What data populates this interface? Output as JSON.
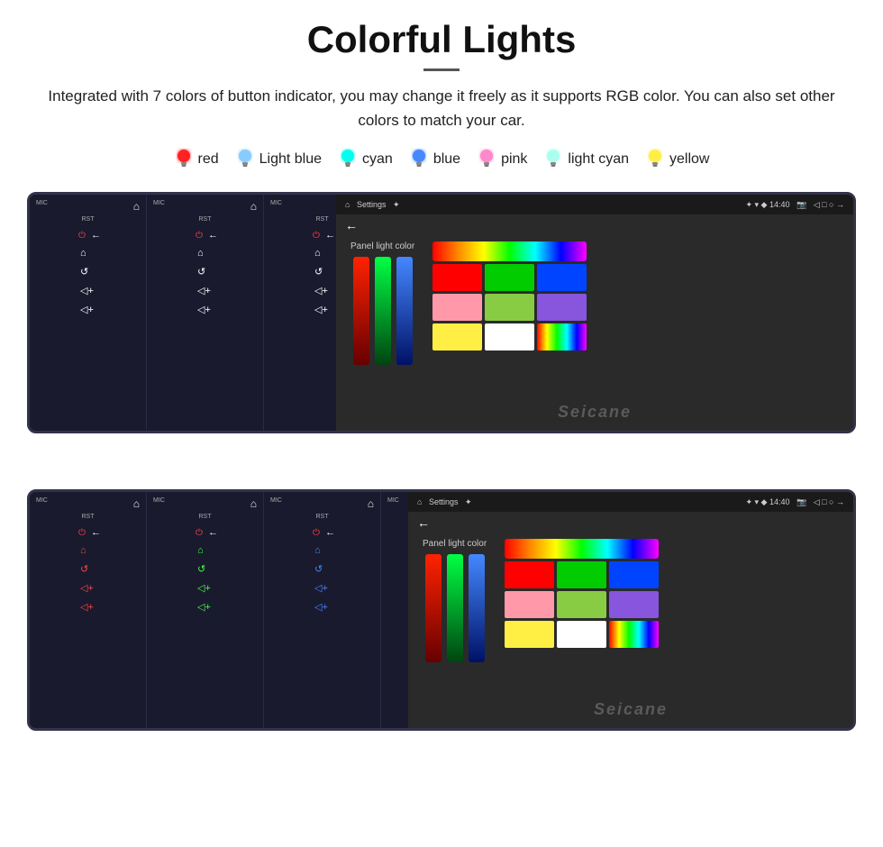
{
  "header": {
    "title": "Colorful Lights",
    "divider": true,
    "description": "Integrated with 7 colors of button indicator, you may change it freely as it supports RGB color. You can also set other colors to match your car."
  },
  "colors": [
    {
      "name": "red",
      "color": "#ff2222",
      "glowColor": "#ff4444"
    },
    {
      "name": "Light blue",
      "color": "#88ddff",
      "glowColor": "#aaddff"
    },
    {
      "name": "cyan",
      "color": "#00ffee",
      "glowColor": "#44ffee"
    },
    {
      "name": "blue",
      "color": "#4488ff",
      "glowColor": "#6699ff"
    },
    {
      "name": "pink",
      "color": "#ff88cc",
      "glowColor": "#ffaadd"
    },
    {
      "name": "light cyan",
      "color": "#aaffee",
      "glowColor": "#ccffee"
    },
    {
      "name": "yellow",
      "color": "#ffee44",
      "glowColor": "#ffff66"
    }
  ],
  "device": {
    "statusBar": {
      "left": "Settings",
      "icons": "✦ ▾ ◆ 14:40",
      "right": "◁ □ ○"
    },
    "sidebar": {
      "labels": [
        "MIC",
        "RST"
      ],
      "icons": [
        "⌂",
        "←",
        "↺",
        "◁+",
        "◁+"
      ]
    },
    "panelLight": {
      "label": "Panel light color"
    }
  },
  "watermark": "Seicane",
  "colorGrid": {
    "row1": [
      "#ff0000",
      "#00cc00",
      "#0044ff"
    ],
    "row2": [
      "#ff99aa",
      "#99dd44",
      "#8855ff"
    ],
    "row3": [
      "#ffaacc",
      "#66cc88",
      "#aaaaee"
    ],
    "row4": [
      "#ffee00",
      "#ffffff",
      "rainbow"
    ]
  }
}
